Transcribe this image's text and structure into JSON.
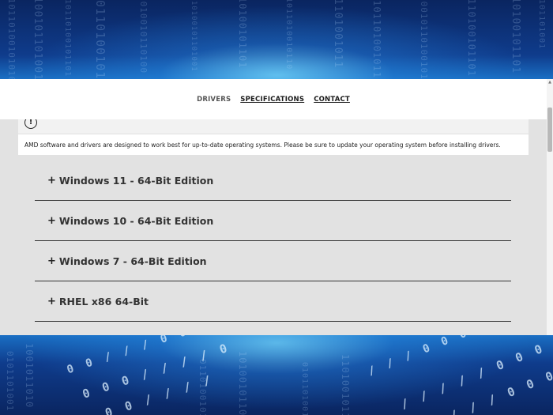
{
  "nav": {
    "items": [
      {
        "label": "DRIVERS"
      },
      {
        "label": "SPECIFICATIONS"
      },
      {
        "label": "CONTACT"
      }
    ]
  },
  "notice": {
    "icon": "alert-circle-icon",
    "text": "AMD software and drivers are designed to work best for up-to-date operating systems. Please be sure to update your operating system before installing drivers."
  },
  "accordion": {
    "items": [
      {
        "label": "Windows 11 - 64-Bit Edition"
      },
      {
        "label": "Windows 10 - 64-Bit Edition"
      },
      {
        "label": "Windows 7 - 64-Bit Edition"
      },
      {
        "label": "RHEL x86 64-Bit"
      }
    ]
  },
  "colors": {
    "background_blue": "#0f3c8c",
    "panel_gray": "#e2e2e2",
    "divider": "#333333"
  }
}
